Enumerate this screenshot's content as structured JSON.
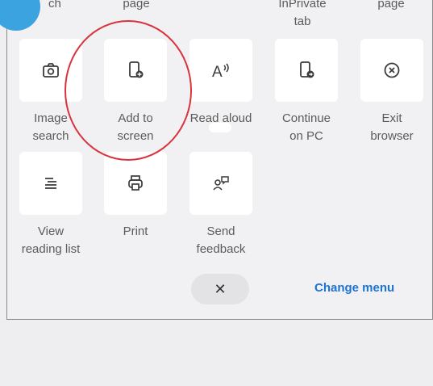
{
  "top_row": {
    "partial_search": "ch",
    "page_1": "page",
    "inprivate_line1": "InPrivate",
    "inprivate_line2": "tab",
    "page_2": "page"
  },
  "menu_items": [
    {
      "icon": "camera-icon",
      "line1": "Image",
      "line2": "search"
    },
    {
      "icon": "add-to-screen-icon",
      "line1": "Add to",
      "line2": "screen"
    },
    {
      "icon": "read-aloud-icon",
      "line1": "Read aloud",
      "line2": ""
    },
    {
      "icon": "continue-on-pc-icon",
      "line1": "Continue",
      "line2": "on PC"
    },
    {
      "icon": "exit-icon",
      "line1": "Exit",
      "line2": "browser"
    },
    {
      "icon": "reading-list-icon",
      "line1": "View",
      "line2": "reading list"
    },
    {
      "icon": "printer-icon",
      "line1": "Print",
      "line2": ""
    },
    {
      "icon": "feedback-icon",
      "line1": "Send",
      "line2": "feedback"
    }
  ],
  "read_aloud_glyph": "A",
  "footer": {
    "close_glyph": "✕",
    "change_menu": "Change menu"
  },
  "colors": {
    "accent_link": "#1b74d4",
    "highlight_circle": "#d8333c",
    "badge": "#3aa3e0"
  }
}
